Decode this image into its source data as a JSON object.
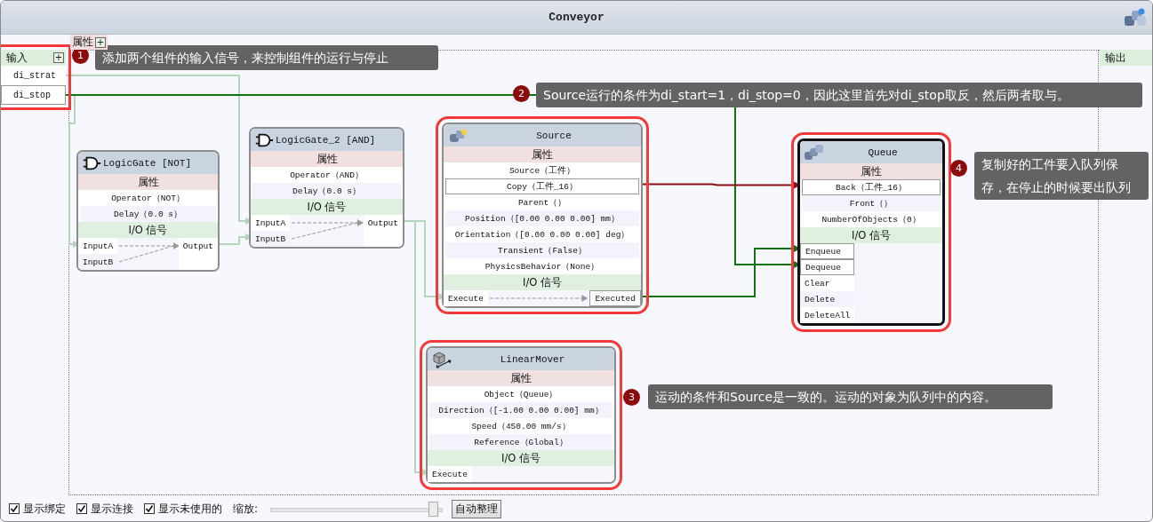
{
  "window": {
    "title": "Conveyor"
  },
  "properties_tab": {
    "label": "属性",
    "add_button": "+"
  },
  "inputs_panel": {
    "label": "输入",
    "add_button": "+",
    "highlighted": true,
    "signals": [
      {
        "name": "di_strat",
        "bound": false
      },
      {
        "name": "di_stop",
        "bound": true
      }
    ]
  },
  "outputs_panel": {
    "label": "输出"
  },
  "nodes": [
    {
      "kind": "logic",
      "title": "LogicGate [NOT]",
      "selected": false,
      "highlighted": false,
      "properties_header": "属性",
      "properties": [
        {
          "text": "Operator（NOT）",
          "bound": false
        },
        {
          "text": "Delay（0.0 s）",
          "bound": false
        }
      ],
      "io_header": "I/O 信号",
      "inputs": [
        {
          "name": "InputA",
          "bound": false
        },
        {
          "name": "InputB",
          "bound": false
        }
      ],
      "outputs": [
        {
          "name": "Output",
          "bound": false
        }
      ]
    },
    {
      "kind": "logic",
      "title": "LogicGate_2 [AND]",
      "selected": false,
      "highlighted": false,
      "properties_header": "属性",
      "properties": [
        {
          "text": "Operator（AND）",
          "bound": false
        },
        {
          "text": "Delay（0.0 s）",
          "bound": false
        }
      ],
      "io_header": "I/O 信号",
      "inputs": [
        {
          "name": "InputA",
          "bound": false
        },
        {
          "name": "InputB",
          "bound": false
        }
      ],
      "outputs": [
        {
          "name": "Output",
          "bound": false
        }
      ]
    },
    {
      "kind": "source",
      "title": "Source",
      "selected": false,
      "highlighted": true,
      "properties_header": "属性",
      "properties": [
        {
          "text": "Source（工件）",
          "bound": false
        },
        {
          "text": "Copy（工件_16）",
          "bound": true
        },
        {
          "text": "Parent（）",
          "bound": false
        },
        {
          "text": "Position（[0.00 0.00 0.00] mm）",
          "bound": false
        },
        {
          "text": "Orientation（[0.00 0.00 0.00] deg）",
          "bound": false
        },
        {
          "text": "Transient（False）",
          "bound": false
        },
        {
          "text": "PhysicsBehavior（None）",
          "bound": false
        }
      ],
      "io_header": "I/O 信号",
      "inputs": [
        {
          "name": "Execute",
          "bound": false
        }
      ],
      "outputs": [
        {
          "name": "Executed",
          "bound": true
        }
      ]
    },
    {
      "kind": "queue",
      "title": "Queue",
      "selected": true,
      "highlighted": true,
      "properties_header": "属性",
      "properties": [
        {
          "text": "Back（工件_16）",
          "bound": true
        },
        {
          "text": "Front（）",
          "bound": false
        },
        {
          "text": "NumberOfObjects（0）",
          "bound": false
        }
      ],
      "io_header": "I/O 信号",
      "inputs": [
        {
          "name": "Enqueue",
          "bound": true
        },
        {
          "name": "Dequeue",
          "bound": true
        },
        {
          "name": "Clear",
          "bound": false
        },
        {
          "name": "Delete",
          "bound": false
        },
        {
          "name": "DeleteAll",
          "bound": false
        }
      ]
    },
    {
      "kind": "mover",
      "title": "LinearMover",
      "selected": false,
      "highlighted": true,
      "properties_header": "属性",
      "properties": [
        {
          "text": "Object（Queue）",
          "bound": false
        },
        {
          "text": "Direction（[-1.00 0.00 0.00] mm）",
          "bound": false
        },
        {
          "text": "Speed（450.00 mm/s）",
          "bound": false
        },
        {
          "text": "Reference（Global）",
          "bound": false
        }
      ],
      "io_header": "I/O 信号",
      "inputs": [
        {
          "name": "Execute",
          "bound": false
        }
      ]
    }
  ],
  "wires": [
    {
      "color": "#b4d4bd"
    },
    {
      "color": "#b4d4bd"
    },
    {
      "color": "#b4d4bd"
    },
    {
      "color": "#b4d4bd"
    },
    {
      "color": "#b4d4bd"
    },
    {
      "color": "#127212"
    },
    {
      "color": "#127212"
    },
    {
      "color": "#8b1010"
    }
  ],
  "callouts": [
    {
      "number": "1",
      "text": "添加两个组件的输入信号，来控制组件的运行与停止"
    },
    {
      "number": "2",
      "text": "Source运行的条件为di_start=1，di_stop=0，因此这里首先对di_stop取反，然后两者取与。"
    },
    {
      "number": "3",
      "text": "运动的条件和Source是一致的。运动的对象为队列中的内容。"
    },
    {
      "number": "4",
      "text": "复制好的工件要入队列保存，在停止的时候要出队列"
    }
  ],
  "bottom_bar": {
    "checkboxes": [
      {
        "label": "显示绑定",
        "checked": true
      },
      {
        "label": "显示连接",
        "checked": true
      },
      {
        "label": "显示未使用的",
        "checked": true
      }
    ],
    "zoom_label": "缩放:",
    "zoom": {
      "level": 0.97
    },
    "arrange_button": "自动整理"
  }
}
